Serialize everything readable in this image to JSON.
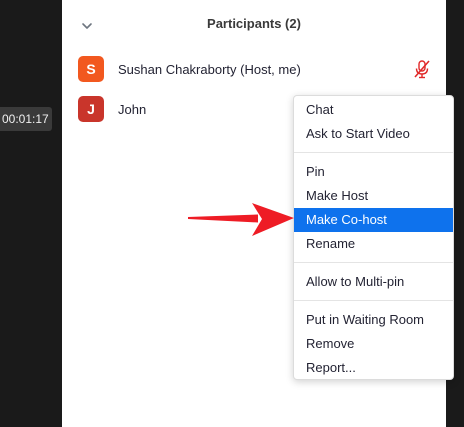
{
  "meeting": {
    "timer": "00:01:17"
  },
  "participants_panel": {
    "title": "Participants (2)",
    "participants": [
      {
        "initial": "S",
        "name": "Sushan Chakraborty (Host, me)",
        "avatar_color": "#f2581f",
        "muted": true
      },
      {
        "initial": "J",
        "name": "John",
        "avatar_color": "#c9352b",
        "muted": false
      }
    ]
  },
  "context_menu": {
    "groups": [
      [
        "Chat",
        "Ask to Start Video"
      ],
      [
        "Pin",
        "Make Host",
        "Make Co-host",
        "Rename"
      ],
      [
        "Allow to Multi-pin"
      ],
      [
        "Put in Waiting Room",
        "Remove",
        "Report..."
      ]
    ],
    "highlighted_item": "Make Co-host",
    "highlight_color": "#0e72ed"
  },
  "annotation": {
    "arrow_color": "#ee1c25",
    "points_to": "Make Co-host"
  },
  "colors": {
    "panel_background": "#ffffff",
    "app_background": "#1a1a1a",
    "mute_icon": "#e02828"
  }
}
